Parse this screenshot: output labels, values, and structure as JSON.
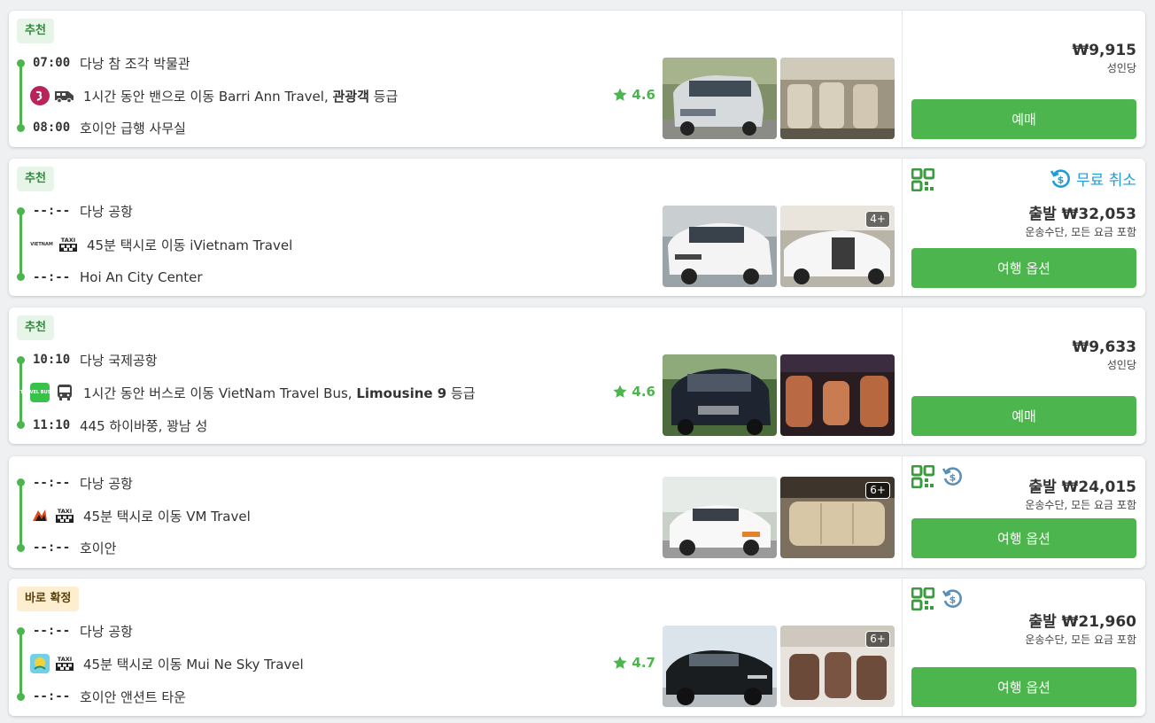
{
  "listings": [
    {
      "badge": "추천",
      "depart_time": "07:00",
      "depart_place": "다낭 참 조각 박물관",
      "desc_pre": "1시간 동안 밴으로 이동 Barri Ann Travel, ",
      "desc_bold": "관광객",
      "desc_post": " 등급",
      "rating": "4.6",
      "arrive_time": "08:00",
      "arrive_place": "호이안 급행 사무실",
      "price": "₩9,915",
      "price_sub": "성인당",
      "button": "예매"
    },
    {
      "badge": "추천",
      "depart_time": "--:--",
      "depart_place": "다낭 공항",
      "desc_pre": "45분 택시로 이동 iVietnam Travel",
      "arrive_time": "--:--",
      "arrive_place": "Hoi An City Center",
      "photo_more": "4+",
      "free_cancel": "무료 취소",
      "price": "출발 ₩32,053",
      "price_sub": "운송수단, 모든 요금 포함",
      "button": "여행 옵션"
    },
    {
      "badge": "추천",
      "depart_time": "10:10",
      "depart_place": "다낭 국제공항",
      "desc_pre": "1시간 동안 버스로 이동 VietNam Travel Bus, ",
      "desc_bold": "Limousine 9",
      "desc_post": " 등급",
      "rating": "4.6",
      "arrive_time": "11:10",
      "arrive_place": "445 하이바쭝, 꽝남 성",
      "price": "₩9,633",
      "price_sub": "성인당",
      "button": "예매"
    },
    {
      "depart_time": "--:--",
      "depart_place": "다낭 공항",
      "desc_pre": "45분 택시로 이동 VM Travel",
      "arrive_time": "--:--",
      "arrive_place": "호이안",
      "photo_more": "6+",
      "price": "출발 ₩24,015",
      "price_sub": "운송수단, 모든 요금 포함",
      "button": "여행 옵션"
    },
    {
      "badge": "바로 확정",
      "depart_time": "--:--",
      "depart_place": "다낭 공항",
      "desc_pre": "45분 택시로 이동 Mui Ne Sky Travel",
      "rating": "4.7",
      "arrive_time": "--:--",
      "arrive_place": "호이안 앤션트 타운",
      "photo_more": "6+",
      "price": "출발 ₩21,960",
      "price_sub": "운송수단, 모든 요금 포함",
      "button": "여행 옵션"
    }
  ],
  "logos": {
    "ivietnam": "VIETNAM",
    "travelbus": "TRAVEL BUS.VN",
    "taxi": "TAXI"
  },
  "colors": {
    "accent": "#4cb54d",
    "free_cancel": "#1e9ed8",
    "badge_green_bg": "#e7f5e8",
    "badge_yellow_bg": "#fdeecf"
  }
}
